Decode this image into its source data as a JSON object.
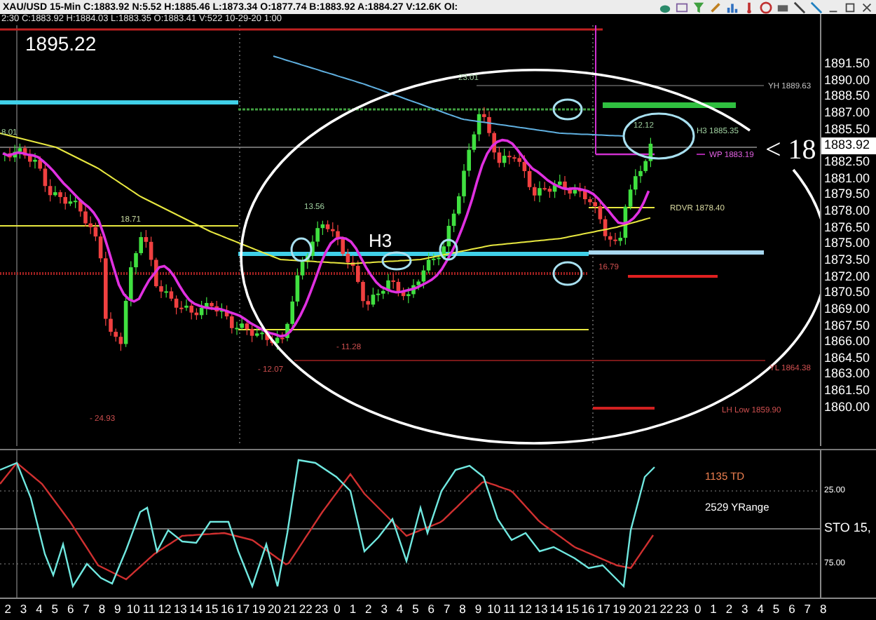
{
  "title_bar": {
    "text": "XAU/USD  15-Min  C:1883.92  N:5.52  H:1885.46  L:1873.34  O:1877.74  B:1883.92  A:1884.27  V:12.6K  OI:"
  },
  "info_line": "2:30  C:1883.92  H:1884.03  L:1883.35  O:1883.41  V:522  10-29-20  1:00",
  "chart": {
    "price_label": "1895.22",
    "h3_marker": "H3",
    "pointer": "< 18",
    "annotations": [
      {
        "text": "8.01",
        "color": "#9fcf9f"
      },
      {
        "text": "18.71",
        "color": "#c8d8a0"
      },
      {
        "text": "13.56",
        "color": "#9fcf9f"
      },
      {
        "text": "- 11.28",
        "color": "#d05050"
      },
      {
        "text": "- 12.07",
        "color": "#d05050"
      },
      {
        "text": "- 24.93",
        "color": "#d05050"
      },
      {
        "text": "23.01",
        "color": "#9fcf9f"
      },
      {
        "text": "12.12",
        "color": "#9fcf9f"
      },
      {
        "text": "YH 1889.63",
        "color": "#c0c0c0"
      },
      {
        "text": "H3 1885.35",
        "color": "#9fcf9f"
      },
      {
        "text": "WP 1883.19",
        "color": "#e060e0"
      },
      {
        "text": "RDVR 1878.40",
        "color": "#d8d8a0"
      },
      {
        "text": "16.79",
        "color": "#d05050"
      },
      {
        "text": "YL 1864.38",
        "color": "#d05050"
      },
      {
        "text": "LH Low 1859.90",
        "color": "#d05050"
      }
    ]
  },
  "price_axis": [
    {
      "text": "1891.50",
      "kind": "tick"
    },
    {
      "text": "1890.00",
      "kind": "tick"
    },
    {
      "text": "1888.50",
      "kind": "tick"
    },
    {
      "text": "1887.00",
      "kind": "tick"
    },
    {
      "text": "1885.50",
      "kind": "tick"
    },
    {
      "text": "1883.92",
      "kind": "current"
    },
    {
      "text": "1882.50",
      "kind": "tick"
    },
    {
      "text": "1881.00",
      "kind": "tick"
    },
    {
      "text": "1879.50",
      "kind": "tick"
    },
    {
      "text": "1878.00",
      "kind": "tick"
    },
    {
      "text": "1876.50",
      "kind": "tick"
    },
    {
      "text": "1875.00",
      "kind": "tick"
    },
    {
      "text": "1873.50",
      "kind": "tick"
    },
    {
      "text": "1872.00",
      "kind": "tick"
    },
    {
      "text": "1870.50",
      "kind": "tick"
    },
    {
      "text": "1869.00",
      "kind": "tick"
    },
    {
      "text": "1867.50",
      "kind": "tick"
    },
    {
      "text": "1866.00",
      "kind": "tick"
    },
    {
      "text": "1864.50",
      "kind": "tick"
    },
    {
      "text": "1863.00",
      "kind": "tick"
    },
    {
      "text": "1861.50",
      "kind": "tick"
    },
    {
      "text": "1860.00",
      "kind": "tick"
    }
  ],
  "oscillator": {
    "labels": [
      {
        "text": "1135 TD",
        "color": "#f08050"
      },
      {
        "text": "2529 YRange",
        "color": "#ffffff"
      }
    ],
    "axis": [
      "25.00",
      "STO  15,",
      "75.00"
    ]
  },
  "time_axis": [
    "2",
    "3",
    "4",
    "5",
    "6",
    "7",
    "8",
    "9",
    "10",
    "11",
    "12",
    "13",
    "14",
    "15",
    "16",
    "17",
    "19",
    "20",
    "21",
    "22",
    "23",
    "0",
    "1",
    "2",
    "3",
    "4",
    "5",
    "6",
    "7",
    "8",
    "9",
    "10",
    "11",
    "12",
    "13",
    "14",
    "15",
    "16",
    "17",
    "19",
    "20",
    "21",
    "22",
    "23",
    "0",
    "1",
    "2",
    "3",
    "4",
    "5",
    "6",
    "7",
    "8"
  ]
}
